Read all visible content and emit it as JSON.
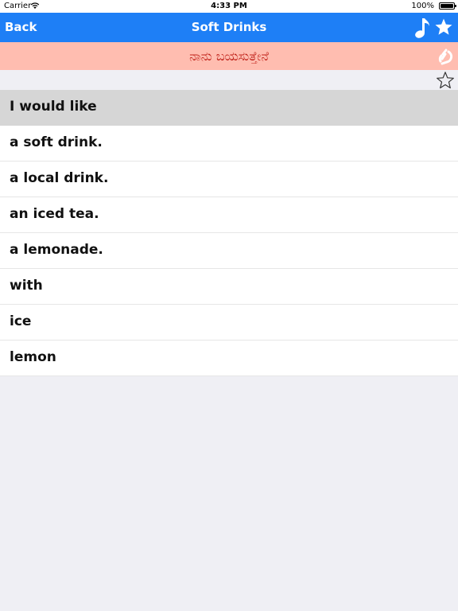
{
  "status": {
    "carrier": "Carrier",
    "time": "4:33 PM",
    "battery": "100%"
  },
  "nav": {
    "back_label": "Back",
    "title": "Soft Drinks"
  },
  "translation": "ನಾನು ಬಯಸುತ್ತೇನೆ",
  "list": {
    "items": [
      "I would like",
      "a soft drink.",
      "a local drink.",
      "an iced tea.",
      "a lemonade.",
      "with",
      "ice",
      "lemon"
    ]
  },
  "colors": {
    "nav_bg": "#1e7ff6",
    "translation_bg": "#ffbdb0",
    "translation_text": "#c0221a",
    "selected_row_bg": "#d6d6d6"
  },
  "icons": {
    "nav_left": "music-note-icon",
    "nav_right": "star-icon",
    "translation_action": "link-icon",
    "favorite": "outline-star-icon"
  }
}
